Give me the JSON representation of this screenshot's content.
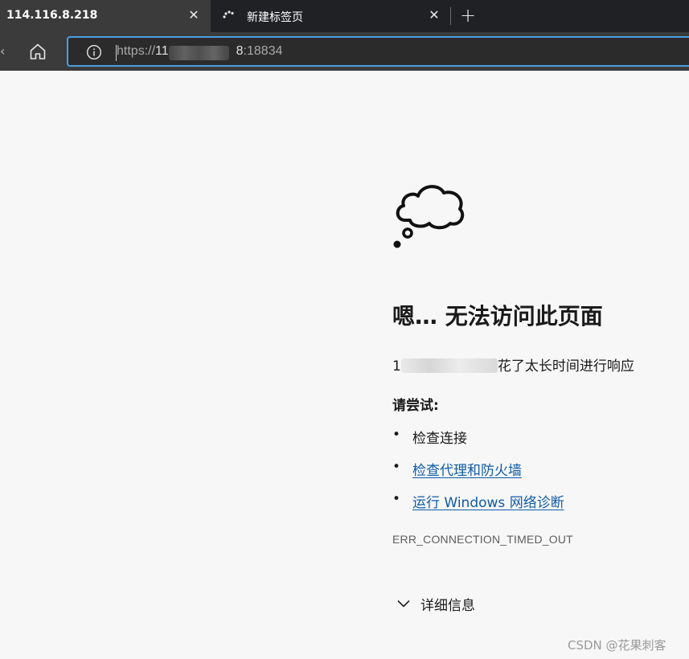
{
  "tabs": [
    {
      "title": "114.116.8.218",
      "active": true,
      "close_label": "✕"
    },
    {
      "title": "新建标签页",
      "active": false,
      "loading": true,
      "close_label": "✕"
    }
  ],
  "new_tab_label": "+",
  "address_bar": {
    "scheme": "https://",
    "host_visible_start": "11",
    "host_visible_end": "8",
    "port": ":18834"
  },
  "error_page": {
    "heading": "嗯… 无法访问此页面",
    "description_prefix": "1",
    "description_suffix": "花了太长时间进行响应",
    "try_heading": "请尝试:",
    "suggestions": [
      {
        "text": "检查连接",
        "link": false
      },
      {
        "text": "检查代理和防火墙",
        "link": true
      },
      {
        "text": "运行 Windows 网络诊断",
        "link": true
      }
    ],
    "error_code": "ERR_CONNECTION_TIMED_OUT",
    "details_label": "详细信息"
  },
  "watermark": "CSDN @花果刺客",
  "icons": {
    "home": "home-icon",
    "info": "info-icon",
    "cloud": "thought-cloud-icon",
    "chevron": "chevron-down-icon",
    "spinner": "loading-spinner-icon"
  },
  "colors": {
    "tab_bar": "#202124",
    "active_tab": "#3b3b3b",
    "omnibox_border": "#4d9de0",
    "link": "#0f5ba7",
    "page_bg": "#f7f7f7"
  }
}
